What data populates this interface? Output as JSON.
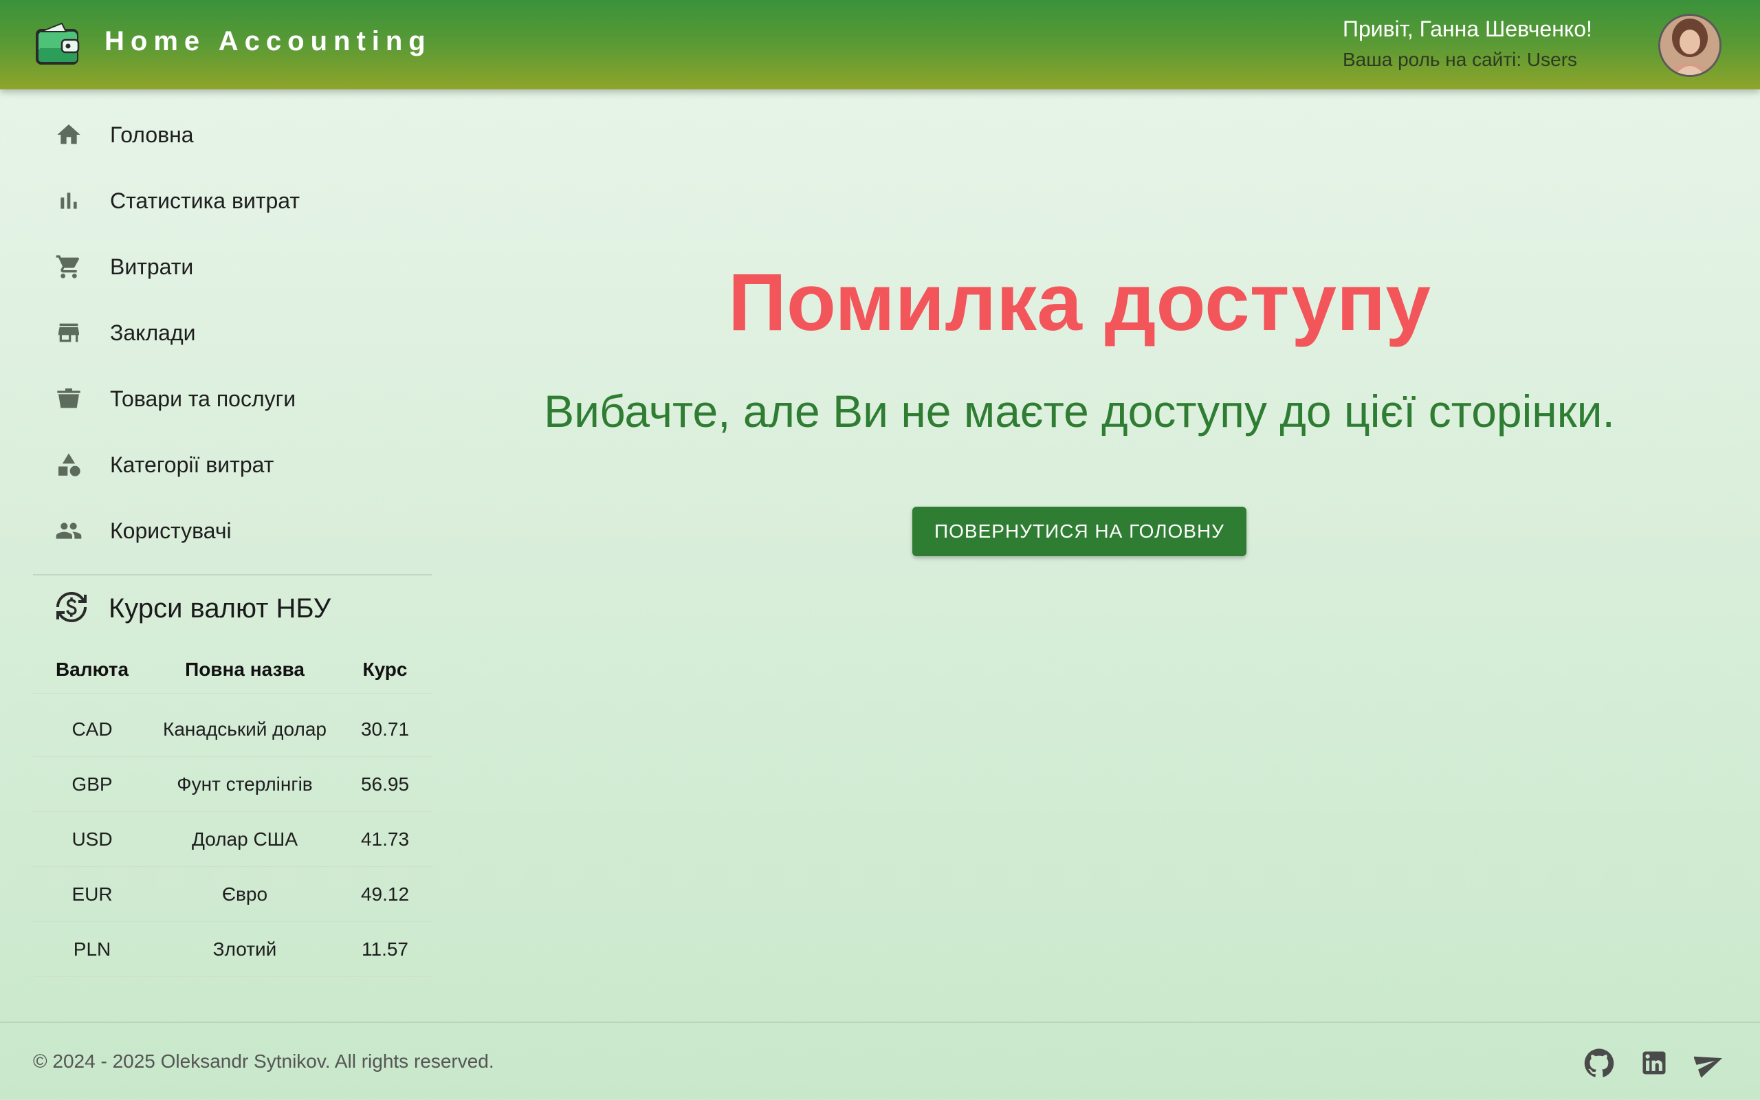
{
  "header": {
    "app_title": "Home Accounting",
    "greeting": "Привіт, Ганна Шевченко!",
    "role_text": "Ваша роль на сайті: Users",
    "logo_icon": "wallet-icon",
    "avatar": "user-avatar"
  },
  "sidebar": {
    "items": [
      {
        "label": "Головна",
        "icon": "home-icon"
      },
      {
        "label": "Статистика витрат",
        "icon": "bar-chart-icon"
      },
      {
        "label": "Витрати",
        "icon": "shopping-cart-icon"
      },
      {
        "label": "Заклади",
        "icon": "store-icon"
      },
      {
        "label": "Товари та послуги",
        "icon": "basket-icon"
      },
      {
        "label": "Категорії витрат",
        "icon": "category-icon"
      },
      {
        "label": "Користувачі",
        "icon": "people-icon"
      }
    ],
    "rates": {
      "title": "Курси валют НБУ",
      "icon": "currency-exchange-icon",
      "headers": [
        "Валюта",
        "Повна назва",
        "Курс"
      ],
      "rows": [
        [
          "CAD",
          "Канадський долар",
          "30.71"
        ],
        [
          "GBP",
          "Фунт стерлінгів",
          "56.95"
        ],
        [
          "USD",
          "Долар США",
          "41.73"
        ],
        [
          "EUR",
          "Євро",
          "49.12"
        ],
        [
          "PLN",
          "Злотий",
          "11.57"
        ]
      ]
    }
  },
  "main": {
    "error_title": "Помилка доступу",
    "error_message": "Вибачте, але Ви не маєте доступу до цієї сторінки.",
    "button_label": "ПОВЕРНУТИСЯ НА ГОЛОВНУ"
  },
  "footer": {
    "copyright": "© 2024 - 2025 Oleksandr Sytnikov. All rights reserved.",
    "social": [
      "github-icon",
      "linkedin-icon",
      "telegram-icon"
    ]
  },
  "colors": {
    "accent": "#2e7d32",
    "error": "#f2555a",
    "header_top": "#3a923a",
    "header_bottom": "#8fa52a"
  }
}
